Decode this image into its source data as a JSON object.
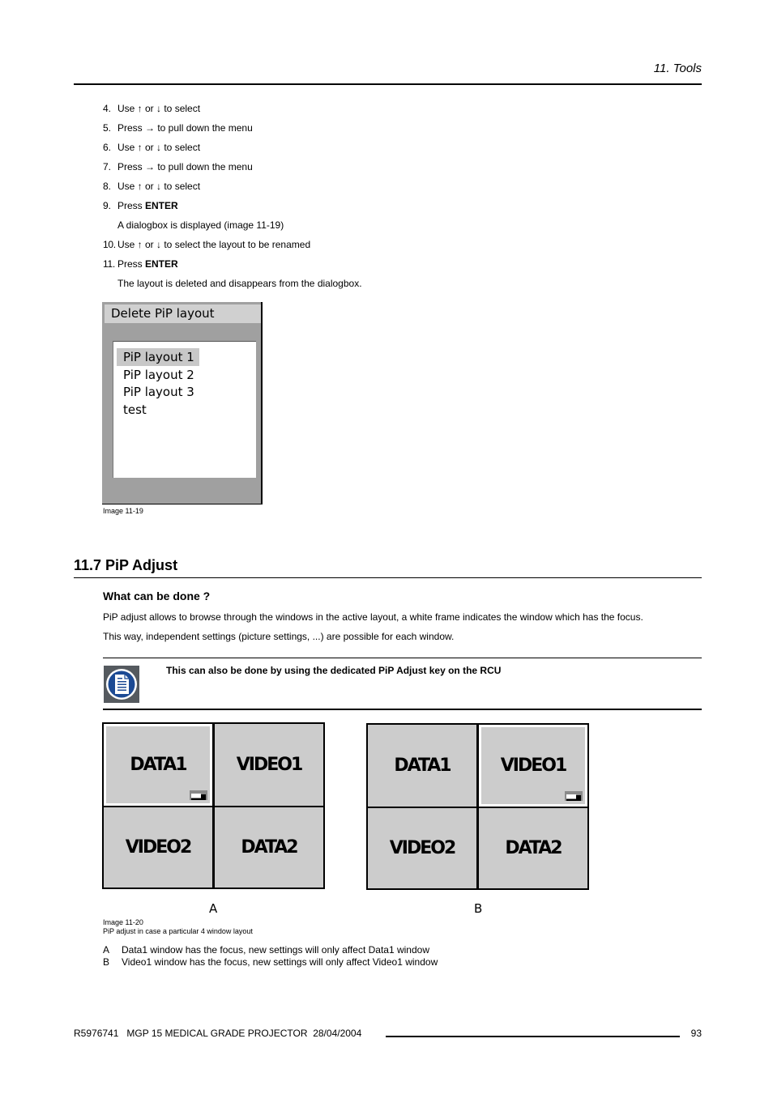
{
  "header": {
    "chapter": "11.  Tools"
  },
  "steps": [
    {
      "num": "4.",
      "parts": [
        "Use ↑ or ↓ to select"
      ]
    },
    {
      "num": "5.",
      "parts": [
        "Press → to pull down the menu"
      ]
    },
    {
      "num": "6.",
      "parts": [
        "Use ↑ or ↓ to select"
      ]
    },
    {
      "num": "7.",
      "parts": [
        "Press → to pull down the menu"
      ]
    },
    {
      "num": "8.",
      "parts": [
        "Use ↑ or ↓ to select"
      ]
    },
    {
      "num": "9.",
      "text": "Press ",
      "bold": "ENTER"
    },
    {
      "num": "",
      "text": "A dialogbox is displayed (image 11-19)"
    },
    {
      "num": "10.",
      "text": "Use ↑ or ↓ to select the layout to be renamed"
    },
    {
      "num": "11.",
      "text": "Press ",
      "bold": "ENTER"
    },
    {
      "num": "",
      "text": "The layout is deleted and disappears from the dialogbox."
    }
  ],
  "dialog": {
    "title": "Delete PiP layout",
    "items": [
      "PiP layout 1",
      "PiP layout 2",
      "PiP layout 3",
      "test"
    ],
    "selected_index": 0,
    "caption": "Image 11-19"
  },
  "section": {
    "title": "11.7 PiP Adjust",
    "subtitle": "What can be done ?",
    "paragraphs": [
      "PiP adjust allows to browse through the windows in the active layout, a white frame indicates the window which has the focus.",
      "This way, independent settings (picture settings, ...) are possible for each window."
    ],
    "note": {
      "icon": "note-document-icon",
      "text": "This can also be done by using the dedicated PiP Adjust key on the RCU"
    }
  },
  "figures": [
    {
      "label": "A",
      "windows": [
        "DATA1",
        "VIDEO1",
        "VIDEO2",
        "DATA2"
      ],
      "focus_index": 0
    },
    {
      "label": "B",
      "windows": [
        "DATA1",
        "VIDEO1",
        "VIDEO2",
        "DATA2"
      ],
      "focus_index": 1
    }
  ],
  "figure_caption": {
    "image": "Image 11-20",
    "text": "PiP adjust in case a particular 4 window layout"
  },
  "legend": [
    {
      "key": "A",
      "text": "Data1 window has the focus, new settings will only affect Data1 window"
    },
    {
      "key": "B",
      "text": "Video1 window has the focus, new settings will only affect Video1 window"
    }
  ],
  "footer": {
    "doc": "R5976741   MGP 15 MEDICAL GRADE PROJECTOR  28/04/2004",
    "page": "93"
  }
}
